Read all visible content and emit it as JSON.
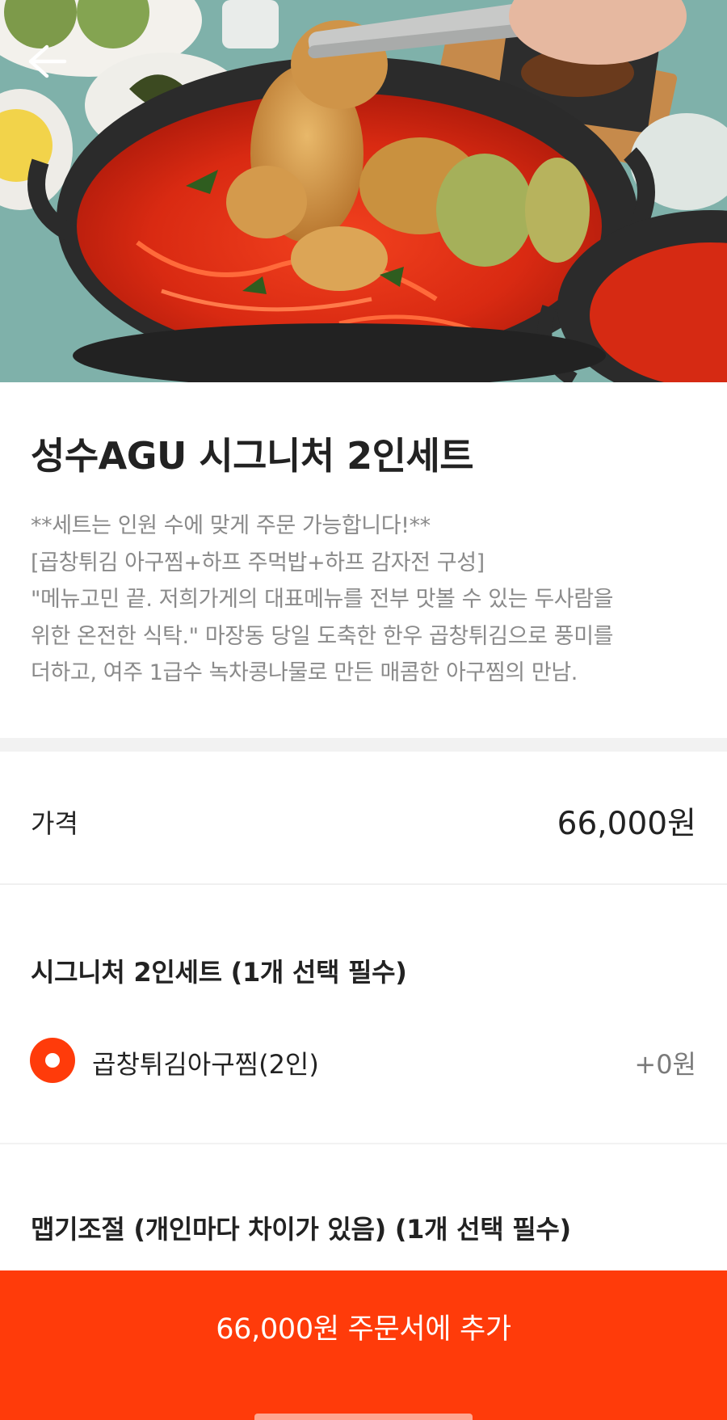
{
  "product": {
    "title": "성수AGU 시그니처 2인세트",
    "description": [
      "**세트는 인원 수에 맞게 주문 가능합니다!**",
      "[곱창튀김 아구찜+하프 주먹밥+하프 감자전 구성]",
      "\"메뉴고민 끝. 저희가게의 대표메뉴를 전부 맛볼 수 있는 두사람을",
      "위한 온전한 식탁.\" 마장동 당일 도축한 한우 곱창튀김으로 풍미를",
      "더하고, 여주 1급수 녹차콩나물로 만든 매콤한 아구찜의 만남."
    ]
  },
  "price": {
    "label": "가격",
    "value": "66,000원"
  },
  "option_groups": [
    {
      "title": "시그니처 2인세트 (1개 선택 필수)",
      "options": [
        {
          "label": "곱창튀김아구찜(2인)",
          "price": "+0원",
          "selected": true
        }
      ]
    },
    {
      "title": "맵기조절 (개인마다 차이가 있음) (1개 선택 필수)"
    }
  ],
  "cta": {
    "label": "66,000원 주문서에 추가"
  },
  "icons": {
    "back": "arrow-left-icon"
  },
  "colors": {
    "accent": "#ff3b0a",
    "description_text": "#8a8a8a"
  }
}
